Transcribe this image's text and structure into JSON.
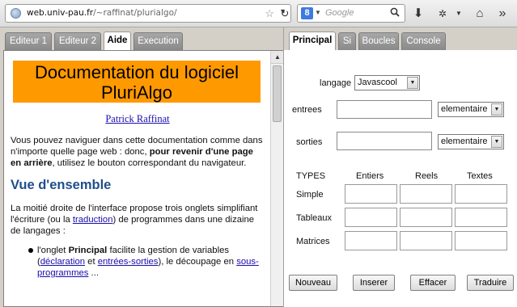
{
  "browser": {
    "url_host": "web.univ-pau.fr",
    "url_path": "/~raffinat/plurialgo/",
    "search_placeholder": "Google",
    "search_engine_letter": "8"
  },
  "left_tabs": [
    "Editeur 1",
    "Editeur 2",
    "Aide",
    "Execution"
  ],
  "active_left_tab": "Aide",
  "doc": {
    "title_line1": "Documentation du logiciel",
    "title_line2": "PluriAlgo",
    "author": "Patrick Raffinat",
    "intro_part1": "Vous pouvez naviguer dans cette documentation comme dans n'importe quelle page web : donc, ",
    "intro_bold": "pour revenir d'une page en arrière",
    "intro_part2": ", utilisez le bouton correspondant du navigateur.",
    "section_heading": "Vue d'ensemble",
    "overview_part1": "La moitié droite de l'interface propose trois onglets simplifiant l'écriture (ou la ",
    "overview_link": "traduction",
    "overview_part2": ") de programmes dans une dizaine de langages :",
    "bullet_part1": "l'onglet ",
    "bullet_bold": "Principal",
    "bullet_part2": " facilite la gestion de variables (",
    "bullet_link1": "déclaration",
    "bullet_and": " et ",
    "bullet_link2": "entrées-sorties",
    "bullet_part3": "), le découpage en ",
    "bullet_link3": "sous-programmes",
    "bullet_part4": " ..."
  },
  "right_tabs": [
    "Principal",
    "Si",
    "Boucles",
    "Console"
  ],
  "active_right_tab": "Principal",
  "form": {
    "langage_label": "langage",
    "langage_value": "Javascool",
    "entrees_label": "entrees",
    "entrees_type": "elementaire",
    "sorties_label": "sorties",
    "sorties_type": "elementaire",
    "types_header": "TYPES",
    "col_entiers": "Entiers",
    "col_reels": "Reels",
    "col_textes": "Textes",
    "row_simple": "Simple",
    "row_tableaux": "Tableaux",
    "row_matrices": "Matrices"
  },
  "buttons": {
    "nouveau": "Nouveau",
    "inserer": "Inserer",
    "effacer": "Effacer",
    "traduire": "Traduire"
  }
}
